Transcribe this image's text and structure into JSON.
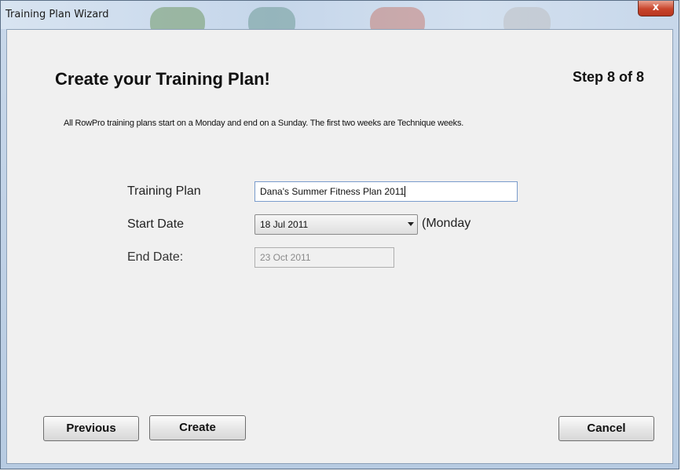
{
  "window": {
    "title": "Training Plan Wizard",
    "close_glyph": "x"
  },
  "header": {
    "heading": "Create your Training Plan!",
    "step": "Step 8 of 8",
    "info": "All RowPro training plans start on a Monday and end on a Sunday.  The first two weeks are Technique weeks."
  },
  "form": {
    "training_plan_label": "Training Plan",
    "training_plan_value": "Dana's Summer Fitness Plan 2011",
    "start_date_label": "Start Date",
    "start_date_value": "18 Jul 2011",
    "start_day_text": "(Monday",
    "end_date_label": "End Date:",
    "end_date_value": "23 Oct 2011"
  },
  "buttons": {
    "previous": "Previous",
    "create": "Create",
    "cancel": "Cancel"
  },
  "icons": {
    "dropdown": "chevron-down-icon",
    "close": "close-icon"
  }
}
